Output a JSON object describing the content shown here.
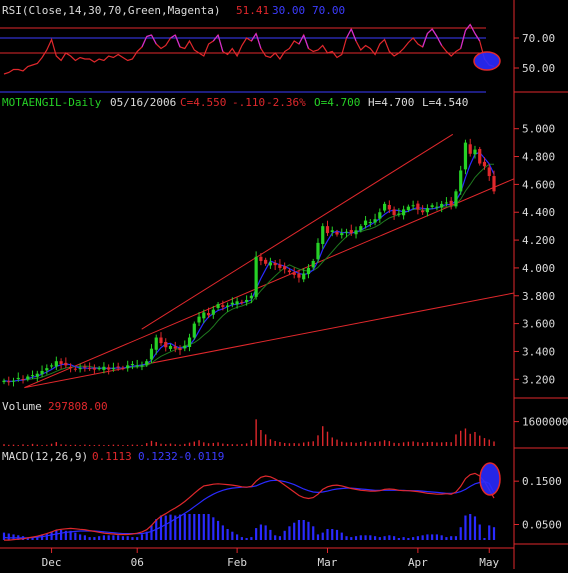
{
  "chart_data": [
    {
      "type": "line",
      "panel": "rsi",
      "header": {
        "label": "RSI(Close,14,30,70,Green,Magenta)",
        "values": [
          "51.41",
          "30.00",
          "70.00"
        ]
      },
      "ylim": [
        38,
        82
      ],
      "y_ticks": [
        "70.00",
        "50.00"
      ],
      "levels": [
        70,
        60
      ],
      "series": [
        {
          "values": [
            46,
            47,
            49,
            49,
            48,
            51,
            52,
            53,
            57,
            62,
            69,
            58,
            55,
            60,
            58,
            55,
            57,
            56,
            56,
            54,
            56,
            55,
            58,
            57,
            59,
            57,
            55,
            56,
            61,
            64,
            71,
            72,
            66,
            63,
            65,
            70,
            72,
            64,
            63,
            68,
            62,
            60,
            58,
            66,
            68,
            72,
            61,
            59,
            63,
            58,
            65,
            70,
            68,
            73,
            63,
            58,
            57,
            60,
            56,
            61,
            63,
            68,
            66,
            72,
            63,
            61,
            62,
            65,
            60,
            61,
            57,
            59,
            70,
            76,
            68,
            62,
            65,
            63,
            59,
            66,
            69,
            61,
            58,
            60,
            63,
            67,
            70,
            66,
            64,
            73,
            76,
            71,
            65,
            61,
            58,
            61,
            63,
            75,
            79,
            73,
            68,
            56,
            52,
            51
          ]
        }
      ],
      "colors": {
        "rsi": "#e0282c",
        "rsi_high": "#cc2ed2",
        "level70": "#3c3cff",
        "level_lower": "#e0282c"
      },
      "annotation": "ellipse-around-last-rsi"
    },
    {
      "type": "candlestick",
      "panel": "price",
      "header": {
        "symbol": "MOTAENGIL-Daily",
        "date": "05/16/2006",
        "close": "C=4.550",
        "change": "-.110",
        "pct": "-2.36%",
        "open": "O=4.700",
        "high": "H=4.700",
        "low": "L=4.540"
      },
      "ylim": [
        3.08,
        5.12
      ],
      "y_ticks": [
        "5.000",
        "4.800",
        "4.600",
        "4.400",
        "4.200",
        "4.000",
        "3.800",
        "3.600",
        "3.400",
        "3.200"
      ],
      "close": [
        3.19,
        3.18,
        3.19,
        3.21,
        3.2,
        3.22,
        3.23,
        3.24,
        3.26,
        3.28,
        3.3,
        3.33,
        3.31,
        3.3,
        3.28,
        3.27,
        3.28,
        3.29,
        3.28,
        3.27,
        3.28,
        3.29,
        3.27,
        3.28,
        3.29,
        3.28,
        3.3,
        3.31,
        3.3,
        3.3,
        3.33,
        3.42,
        3.5,
        3.46,
        3.43,
        3.44,
        3.42,
        3.41,
        3.44,
        3.5,
        3.6,
        3.65,
        3.68,
        3.66,
        3.7,
        3.74,
        3.72,
        3.73,
        3.75,
        3.76,
        3.75,
        3.77,
        3.8,
        4.08,
        4.05,
        4.03,
        4.04,
        4.02,
        4,
        3.99,
        3.97,
        3.95,
        3.93,
        3.96,
        4,
        4.05,
        4.18,
        4.3,
        4.25,
        4.27,
        4.24,
        4.25,
        4.26,
        4.25,
        4.27,
        4.3,
        4.34,
        4.33,
        4.35,
        4.4,
        4.46,
        4.42,
        4.38,
        4.39,
        4.42,
        4.44,
        4.45,
        4.42,
        4.4,
        4.43,
        4.45,
        4.44,
        4.46,
        4.47,
        4.45,
        4.55,
        4.7,
        4.9,
        4.82,
        4.85,
        4.75,
        4.73,
        4.66,
        4.55
      ],
      "high_peak": "4.940",
      "colors": {
        "up": "#26d126",
        "down": "#e0282c",
        "ma_fast": "#2a2aff",
        "ma_slow": "#1f7a1f",
        "trendline": "#e0282c"
      },
      "trendlines": [
        {
          "from": [
            0.04,
            3.14
          ],
          "to": [
            1.0,
            4.64
          ]
        },
        {
          "from": [
            0.27,
            3.56
          ],
          "to": [
            0.88,
            4.96
          ]
        },
        {
          "from": [
            0.04,
            3.14
          ],
          "to": [
            1.0,
            3.82
          ]
        }
      ]
    },
    {
      "type": "bar",
      "panel": "volume",
      "header": {
        "label": "Volume",
        "value": "297808.00"
      },
      "y_ticks": [
        "1600000"
      ],
      "ylim": [
        0,
        2100000
      ],
      "values": [
        120000,
        80000,
        90000,
        60000,
        110000,
        70000,
        140000,
        90000,
        60000,
        80000,
        150000,
        260000,
        110000,
        90000,
        70000,
        80000,
        60000,
        90000,
        70000,
        60000,
        80000,
        60000,
        70000,
        90000,
        80000,
        60000,
        70000,
        90000,
        80000,
        70000,
        190000,
        340000,
        260000,
        150000,
        120000,
        160000,
        110000,
        90000,
        140000,
        220000,
        290000,
        380000,
        240000,
        180000,
        200000,
        240000,
        160000,
        130000,
        120000,
        110000,
        130000,
        170000,
        390000,
        1750000,
        1050000,
        760000,
        440000,
        330000,
        260000,
        200000,
        180000,
        190000,
        170000,
        230000,
        280000,
        310000,
        700000,
        1300000,
        940000,
        560000,
        420000,
        280000,
        230000,
        250000,
        210000,
        260000,
        320000,
        230000,
        260000,
        300000,
        380000,
        320000,
        210000,
        190000,
        240000,
        280000,
        300000,
        250000,
        210000,
        260000,
        270000,
        230000,
        240000,
        260000,
        250000,
        760000,
        1000000,
        1150000,
        800000,
        920000,
        680000,
        520000,
        420000,
        297808
      ],
      "colors": {
        "bar": "#e0282c"
      }
    },
    {
      "type": "bar",
      "panel": "macd",
      "header": {
        "label": "MACD(12,26,9)",
        "values": [
          "0.1113",
          "0.1232",
          "-0.0119"
        ]
      },
      "ylim": [
        0.005,
        0.185
      ],
      "y_ticks": [
        "0.1500",
        "0.0500"
      ],
      "macd": [
        0.014,
        0.014,
        0.015,
        0.016,
        0.017,
        0.019,
        0.021,
        0.023,
        0.026,
        0.029,
        0.033,
        0.037,
        0.039,
        0.04,
        0.041,
        0.04,
        0.039,
        0.038,
        0.036,
        0.034,
        0.032,
        0.03,
        0.029,
        0.028,
        0.027,
        0.027,
        0.027,
        0.028,
        0.03,
        0.033,
        0.038,
        0.048,
        0.06,
        0.069,
        0.075,
        0.082,
        0.088,
        0.095,
        0.103,
        0.112,
        0.122,
        0.131,
        0.139,
        0.141,
        0.143,
        0.144,
        0.143,
        0.142,
        0.141,
        0.139,
        0.137,
        0.136,
        0.138,
        0.15,
        0.159,
        0.162,
        0.16,
        0.155,
        0.149,
        0.141,
        0.133,
        0.125,
        0.117,
        0.112,
        0.11,
        0.112,
        0.12,
        0.131,
        0.137,
        0.14,
        0.141,
        0.139,
        0.136,
        0.133,
        0.131,
        0.129,
        0.128,
        0.127,
        0.127,
        0.128,
        0.131,
        0.132,
        0.131,
        0.129,
        0.128,
        0.128,
        0.127,
        0.126,
        0.124,
        0.122,
        0.121,
        0.12,
        0.12,
        0.121,
        0.12,
        0.125,
        0.138,
        0.156,
        0.165,
        0.168,
        0.162,
        0.149,
        0.131,
        0.111
      ],
      "signal": [
        0.02,
        0.019,
        0.019,
        0.019,
        0.019,
        0.019,
        0.02,
        0.021,
        0.022,
        0.024,
        0.026,
        0.028,
        0.03,
        0.032,
        0.033,
        0.034,
        0.035,
        0.035,
        0.035,
        0.035,
        0.034,
        0.033,
        0.032,
        0.031,
        0.03,
        0.029,
        0.029,
        0.029,
        0.029,
        0.029,
        0.031,
        0.034,
        0.039,
        0.044,
        0.05,
        0.056,
        0.063,
        0.069,
        0.076,
        0.083,
        0.091,
        0.099,
        0.107,
        0.114,
        0.12,
        0.125,
        0.129,
        0.132,
        0.134,
        0.135,
        0.136,
        0.136,
        0.137,
        0.139,
        0.144,
        0.148,
        0.151,
        0.152,
        0.151,
        0.149,
        0.146,
        0.142,
        0.137,
        0.132,
        0.128,
        0.125,
        0.124,
        0.125,
        0.127,
        0.13,
        0.132,
        0.133,
        0.134,
        0.134,
        0.133,
        0.132,
        0.131,
        0.13,
        0.129,
        0.129,
        0.129,
        0.129,
        0.129,
        0.129,
        0.129,
        0.128,
        0.128,
        0.128,
        0.127,
        0.126,
        0.125,
        0.124,
        0.123,
        0.122,
        0.122,
        0.123,
        0.126,
        0.131,
        0.138,
        0.144,
        0.147,
        0.149,
        0.145,
        0.123
      ],
      "x_labels": [
        {
          "label": "Dec",
          "index": 10
        },
        {
          "label": "06",
          "index": 28
        },
        {
          "label": "Feb",
          "index": 49
        },
        {
          "label": "Mar",
          "index": 68
        },
        {
          "label": "Apr",
          "index": 87
        },
        {
          "label": "May",
          "index": 102
        }
      ],
      "colors": {
        "macd": "#e0282c",
        "signal": "#2a2aff",
        "histogram": "#2a2aff"
      },
      "annotation": "ellipse-around-last-macd"
    }
  ]
}
